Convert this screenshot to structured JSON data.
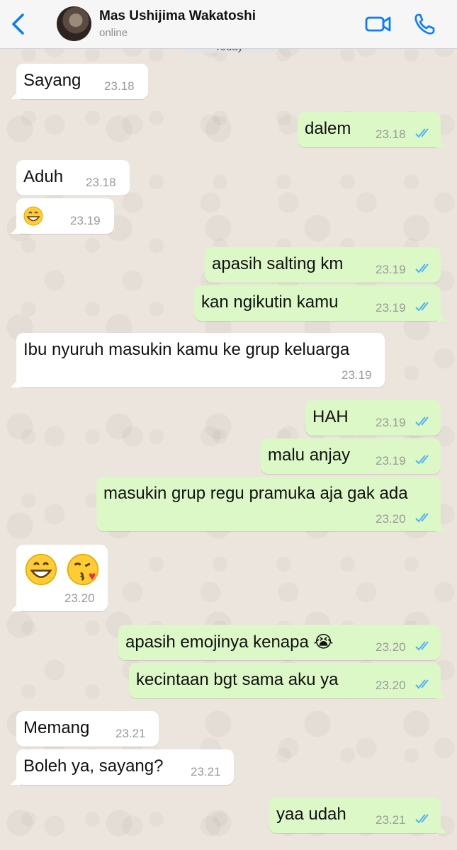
{
  "header": {
    "contact_name": "Mas Ushijima Wakatoshi",
    "contact_status": "online",
    "date_label": "Today"
  },
  "colors": {
    "incoming_bubble": "#ffffff",
    "outgoing_bubble": "#dcf8c6",
    "accent": "#0a7cff",
    "read_ticks": "#4fb3f6"
  },
  "icons": [
    "back-chevron-icon",
    "video-call-icon",
    "phone-icon",
    "double-check-icon"
  ],
  "messages": [
    {
      "direction": "in",
      "text": "Sayang",
      "time": "23.18"
    },
    {
      "direction": "out",
      "text": "dalem",
      "time": "23.18",
      "read": true
    },
    {
      "direction": "in",
      "text": "Aduh",
      "time": "23.18"
    },
    {
      "direction": "in",
      "text": "😁",
      "time": "23.19"
    },
    {
      "direction": "out",
      "text": "apasih salting km",
      "time": "23.19",
      "read": true
    },
    {
      "direction": "out",
      "text": "kan ngikutin kamu",
      "time": "23.19",
      "read": true
    },
    {
      "direction": "in",
      "text": "Ibu nyuruh masukin kamu ke grup keluarga",
      "time": "23.19"
    },
    {
      "direction": "out",
      "text": "HAH",
      "time": "23.19",
      "read": true
    },
    {
      "direction": "out",
      "text": "malu anjay",
      "time": "23.19",
      "read": true
    },
    {
      "direction": "out",
      "text": "masukin grup regu pramuka aja gak ada",
      "time": "23.20",
      "read": true
    },
    {
      "direction": "in",
      "text": "😁😘",
      "time": "23.20"
    },
    {
      "direction": "out",
      "text": "apasih emojinya kenapa 😭",
      "time": "23.20",
      "read": true
    },
    {
      "direction": "out",
      "text": "kecintaan bgt sama aku ya",
      "time": "23.20",
      "read": true
    },
    {
      "direction": "in",
      "text": "Memang",
      "time": "23.21"
    },
    {
      "direction": "in",
      "text": "Boleh ya, sayang?",
      "time": "23.21"
    },
    {
      "direction": "out",
      "text": "yaa udah",
      "time": "23.21",
      "read": true
    }
  ]
}
